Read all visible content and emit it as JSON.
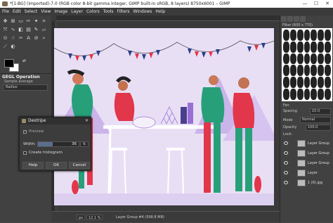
{
  "window": {
    "title": "*[1-BG] (imported)-7.0 (RGB color 8-bit gamma integer, GIMP built-in sRGB, 8 layers) 8750x6001 – GIMP",
    "minimize": "—",
    "maximize": "☐",
    "close": "✕"
  },
  "menubar": {
    "items": [
      "File",
      "Edit",
      "Select",
      "View",
      "Image",
      "Layer",
      "Colors",
      "Tools",
      "Filters",
      "Windows",
      "Help"
    ]
  },
  "tool_options": {
    "title": "GEGL Operation",
    "subtitle": "Sample average",
    "radius_label": "Radius"
  },
  "right_panel": {
    "brush_filter": "Filter (600 x 770)",
    "brush_name": "Fan",
    "spacing_label": "Spacing",
    "spacing_value": "10.0",
    "mode_label": "Mode",
    "mode_value": "Normal",
    "opacity_label": "Opacity",
    "opacity_value": "100.0",
    "lock_label": "Lock:",
    "layers": [
      {
        "name": "Layer Group"
      },
      {
        "name": "Layer Group"
      },
      {
        "name": "Layer Group"
      },
      {
        "name": "Layer"
      },
      {
        "name": "1 (6).jpg"
      }
    ]
  },
  "status": {
    "unit": "px",
    "zoom": "12.1 %",
    "layer_info": "Layer Group #4 (598.8 MB)"
  },
  "dialog": {
    "title": "Destripe",
    "preview_label": "Preview",
    "preview_checked": true,
    "width_label": "Width:",
    "width_value": "36",
    "width_max": 100,
    "create_histogram_label": "Create histogram",
    "create_histogram_checked": false,
    "help_button": "Help",
    "ok_button": "OK",
    "cancel_button": "Cancel"
  },
  "colors": {
    "canvas_bg": "#e9dff5",
    "accent_purple": "#9a6fd6",
    "figure_green": "#27a07a",
    "figure_red": "#e2364b",
    "bunting_blue": "#2b3f8c"
  }
}
